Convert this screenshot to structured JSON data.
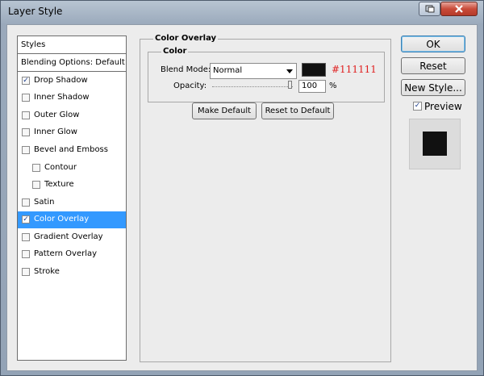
{
  "window": {
    "title": "Layer Style"
  },
  "sidebar": {
    "header1": "Styles",
    "header2": "Blending Options: Default",
    "items": [
      {
        "label": "Drop Shadow",
        "checked": true
      },
      {
        "label": "Inner Shadow",
        "checked": false
      },
      {
        "label": "Outer Glow",
        "checked": false
      },
      {
        "label": "Inner Glow",
        "checked": false
      },
      {
        "label": "Bevel and Emboss",
        "checked": false
      },
      {
        "label": "Contour",
        "checked": false
      },
      {
        "label": "Texture",
        "checked": false
      },
      {
        "label": "Satin",
        "checked": false
      },
      {
        "label": "Color Overlay",
        "checked": true,
        "selected": true
      },
      {
        "label": "Gradient Overlay",
        "checked": false
      },
      {
        "label": "Pattern Overlay",
        "checked": false
      },
      {
        "label": "Stroke",
        "checked": false
      }
    ]
  },
  "panel": {
    "title": "Color Overlay",
    "group_title": "Color",
    "blend_mode_label": "Blend Mode:",
    "blend_mode_value": "Normal",
    "color_hex": "#111111",
    "opacity_label": "Opacity:",
    "opacity_value": "100",
    "opacity_unit": "%",
    "opacity_level": 1.0,
    "make_default": "Make Default",
    "reset_default": "Reset to Default"
  },
  "actions": {
    "ok": "OK",
    "reset": "Reset",
    "new_style": "New Style...",
    "preview_label": "Preview",
    "preview_checked": true
  },
  "colors": {
    "selection": "#3399ff",
    "hex_text": "#e02020",
    "overlay": "#111111"
  }
}
